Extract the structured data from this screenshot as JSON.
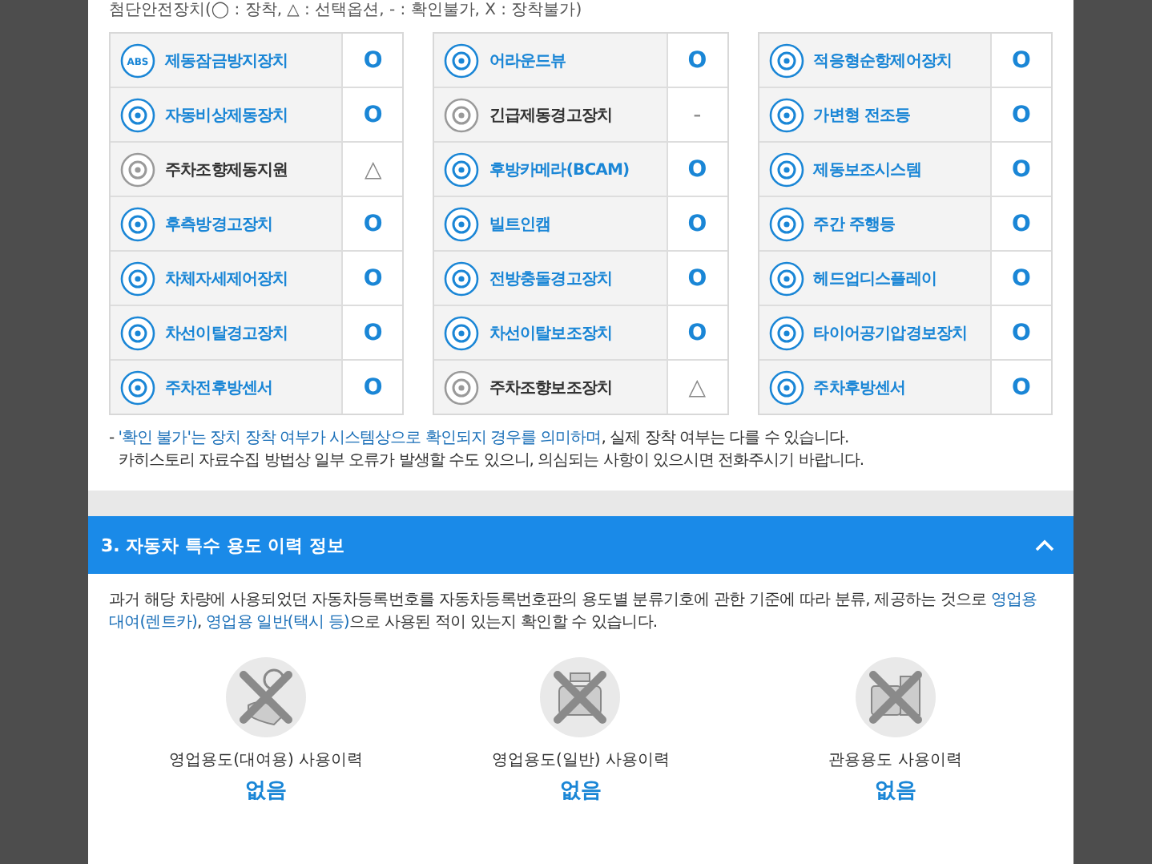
{
  "legend": "첨단안전장치(◯ : 장착, △ : 선택옵션, - : 확인불가, X : 장착불가)",
  "device_tables": [
    {
      "items": [
        {
          "name": "제동잠금방지장치",
          "value": "O",
          "installed": true,
          "icon_text": "ABS"
        },
        {
          "name": "자동비상제동장치",
          "value": "O",
          "installed": true
        },
        {
          "name": "주차조향제동지원",
          "value": "△",
          "installed": false
        },
        {
          "name": "후측방경고장치",
          "value": "O",
          "installed": true
        },
        {
          "name": "차체자세제어장치",
          "value": "O",
          "installed": true
        },
        {
          "name": "차선이탈경고장치",
          "value": "O",
          "installed": true
        },
        {
          "name": "주차전후방센서",
          "value": "O",
          "installed": true
        }
      ]
    },
    {
      "items": [
        {
          "name": "어라운드뷰",
          "value": "O",
          "installed": true
        },
        {
          "name": "긴급제동경고장치",
          "value": "-",
          "installed": false
        },
        {
          "name": "후방카메라(BCAM)",
          "value": "O",
          "installed": true
        },
        {
          "name": "빌트인캠",
          "value": "O",
          "installed": true
        },
        {
          "name": "전방충돌경고장치",
          "value": "O",
          "installed": true
        },
        {
          "name": "차선이탈보조장치",
          "value": "O",
          "installed": true
        },
        {
          "name": "주차조향보조장치",
          "value": "△",
          "installed": false
        }
      ]
    },
    {
      "items": [
        {
          "name": "적응형순항제어장치",
          "value": "O",
          "installed": true
        },
        {
          "name": "가변형 전조등",
          "value": "O",
          "installed": true
        },
        {
          "name": "제동보조시스템",
          "value": "O",
          "installed": true
        },
        {
          "name": "주간 주행등",
          "value": "O",
          "installed": true
        },
        {
          "name": "헤드업디스플레이",
          "value": "O",
          "installed": true
        },
        {
          "name": "타이어공기압경보장치",
          "value": "O",
          "installed": true
        },
        {
          "name": "주차후방센서",
          "value": "O",
          "installed": true
        }
      ]
    }
  ],
  "notes": [
    {
      "segments": [
        {
          "text": "- ",
          "emphasis": false
        },
        {
          "text": "'확인 불가'는 장치 장착 여부가 시스템상으로 확인되지 경우를 의미하며",
          "emphasis": true
        },
        {
          "text": ", 실제 장착 여부는 다를 수 있습니다.",
          "emphasis": false
        }
      ]
    },
    {
      "segments": [
        {
          "text": "카히스토리 자료수집 방법상 일부 오류가 발생할 수도 있으니, 의심되는 사항이 있으시면 전화주시기 바랍니다.",
          "emphasis": false
        }
      ]
    }
  ],
  "section": {
    "title": "3. 자동차 특수 용도 이력 정보",
    "expanded": true,
    "description": [
      {
        "text": "과거 해당 차량에 사용되었던 자동차등록번호를 자동차등록번호판의 용도별 분류기호에 관한 기준에 따라 분류, 제공하는 것으로 ",
        "emphasis": false
      },
      {
        "text": "영업용 대여(렌트카)",
        "emphasis": true
      },
      {
        "text": ", ",
        "emphasis": false
      },
      {
        "text": "영업용 일반(택시 등)",
        "emphasis": true
      },
      {
        "text": "으로 사용된 적이 있는지 확인할 수 있습니다.",
        "emphasis": false
      }
    ],
    "usage": [
      {
        "label": "영업용도(대여용) 사용이력",
        "value": "없음"
      },
      {
        "label": "영업용도(일반) 사용이력",
        "value": "없음"
      },
      {
        "label": "관용용도 사용이력",
        "value": "없음"
      }
    ]
  }
}
